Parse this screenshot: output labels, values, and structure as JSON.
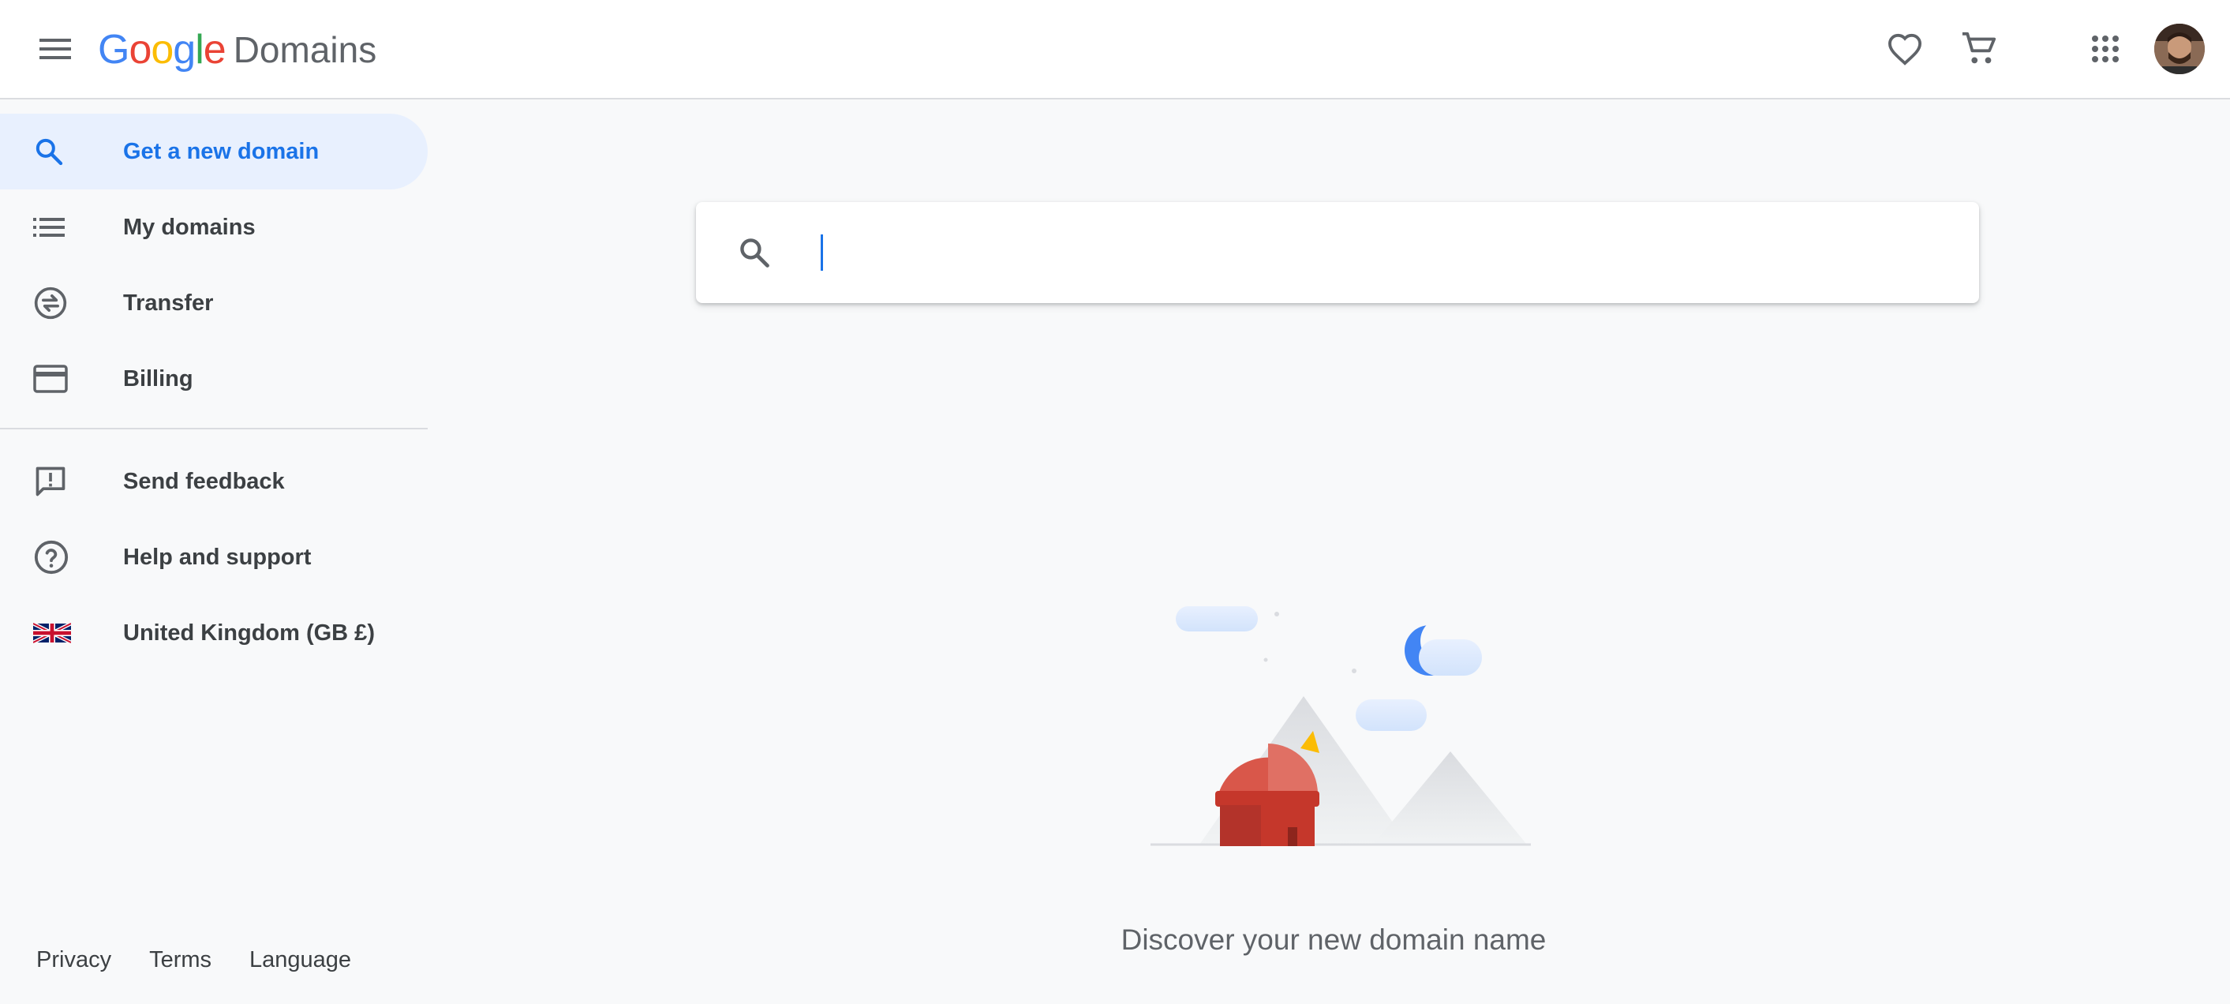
{
  "header": {
    "logo_google": "Google",
    "logo_product": "Domains",
    "icons": [
      "menu-icon",
      "heart-icon",
      "cart-icon",
      "apps-grid-icon",
      "avatar"
    ]
  },
  "sidebar": {
    "items": [
      {
        "label": "Get a new domain",
        "icon": "search-icon",
        "active": true
      },
      {
        "label": "My domains",
        "icon": "list-icon"
      },
      {
        "label": "Transfer",
        "icon": "transfer-icon"
      },
      {
        "label": "Billing",
        "icon": "credit-card-icon"
      },
      {
        "label": "Send feedback",
        "icon": "feedback-icon"
      },
      {
        "label": "Help and support",
        "icon": "help-icon"
      },
      {
        "label": "United Kingdom (GB £)",
        "icon": "uk-flag-icon"
      }
    ],
    "footer": {
      "privacy": "Privacy",
      "terms": "Terms",
      "language": "Language"
    }
  },
  "main": {
    "search": {
      "value": "",
      "placeholder": ""
    },
    "tagline": "Discover your new domain name"
  },
  "colors": {
    "accent": "#1a73e8",
    "active_bg": "#e8f0fe",
    "page_bg": "#f8f9fa"
  }
}
